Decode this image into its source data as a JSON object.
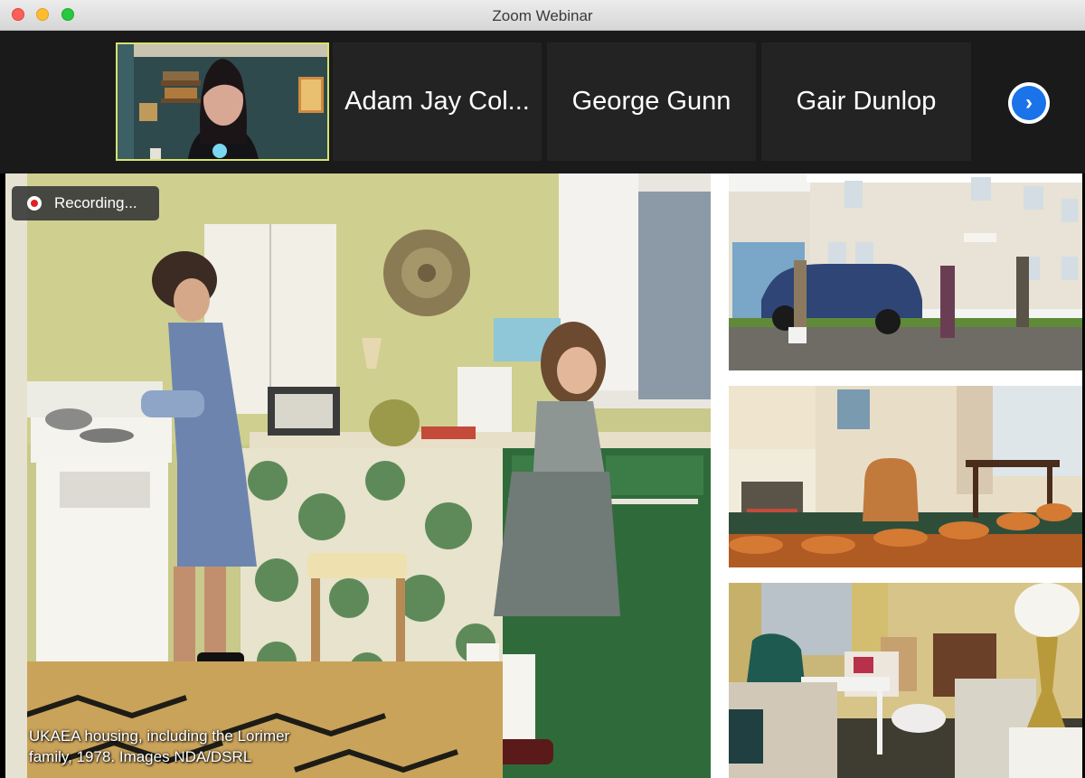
{
  "window": {
    "title": "Zoom Webinar"
  },
  "participants": [
    {
      "name": "",
      "type": "video"
    },
    {
      "name": "Adam Jay Col...",
      "type": "name"
    },
    {
      "name": "George Gunn",
      "type": "name"
    },
    {
      "name": "Gair Dunlop",
      "type": "name"
    }
  ],
  "recording": {
    "label": "Recording..."
  },
  "slide": {
    "caption_line1": "UKAEA housing, including the Lorimer",
    "caption_line2": "family, 1978. Images NDA/DSRL"
  },
  "icons": {
    "next": "chevron-right-icon",
    "recording": "record-dot-icon"
  },
  "colors": {
    "accent": "#1a73e8",
    "recording": "#e02020",
    "active_speaker_border": "#d8e26c"
  }
}
